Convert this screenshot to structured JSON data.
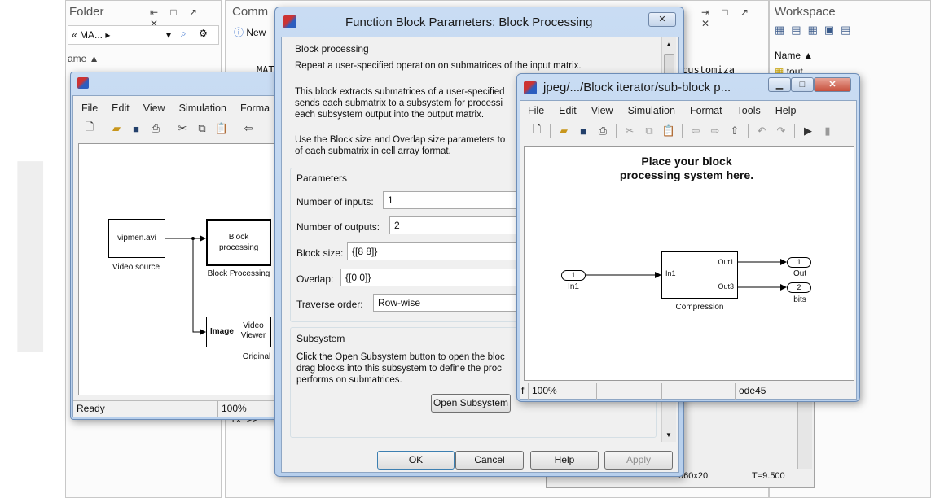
{
  "desktop": {
    "folder_title": "Folder",
    "folder_path": "« MA... ▸",
    "folder_col": "ame ▲",
    "command_title": "Comm",
    "command_new": "New",
    "command_text1": "MAT",
    "command_text2": "customiza",
    "command_prompt": "fx >>",
    "workspace_title": "Workspace",
    "workspace_col": "Name ▲",
    "workspace_var": "tout",
    "size_readout": "960x20",
    "time_readout": "T=9.500"
  },
  "model": {
    "menu": [
      "File",
      "Edit",
      "View",
      "Simulation",
      "Forma"
    ],
    "video_source_label": "vipmen.avi",
    "video_source_caption": "Video source",
    "block_proc_label": "Block processing",
    "block_proc_caption": "Block Processing",
    "viewer_in": "Image",
    "viewer_label": "Video Viewer",
    "viewer_caption": "Original",
    "status_ready": "Ready",
    "status_zoom": "100%"
  },
  "dialog": {
    "title": "Function Block Parameters: Block Processing",
    "section1": "Block processing",
    "desc1": "Repeat a user-specified operation on submatrices of the input matrix.",
    "desc2a": "This block extracts submatrices of a user-specified",
    "desc2b": "sends each submatrix to a subsystem for processi",
    "desc2c": "each subsystem output into the output matrix.",
    "desc3a": "Use the Block size and Overlap size parameters to",
    "desc3b": "of each submatrix in cell array format.",
    "params_title": "Parameters",
    "inputs_label": "Number of inputs:",
    "inputs_value": "1",
    "outputs_label": "Number of outputs:",
    "outputs_value": "2",
    "blocksize_label": "Block size:",
    "blocksize_value": "{[8 8]}",
    "overlap_label": "Overlap:",
    "overlap_value": "{[0 0]}",
    "traverse_label": "Traverse order:",
    "traverse_value": "Row-wise",
    "subsystem_title": "Subsystem",
    "sub1": "Click the Open Subsystem button to open the bloc",
    "sub2": "drag blocks into this subsystem to define the proc",
    "sub3": "performs on submatrices.",
    "open_subsystem": "Open Subsystem",
    "ok": "OK",
    "cancel": "Cancel",
    "help": "Help",
    "apply": "Apply"
  },
  "subwin": {
    "title": "jpeg/.../Block iterator/sub-block p...",
    "menu": [
      "File",
      "Edit",
      "View",
      "Simulation",
      "Format",
      "Tools",
      "Help"
    ],
    "heading1": "Place your block",
    "heading2": "processing system here.",
    "in_num": "1",
    "in_label": "In1",
    "block_in": "In1",
    "block_out1": "Out1",
    "block_out3": "Out3",
    "block_caption": "Compression",
    "out1_num": "1",
    "out1_label": "Out",
    "out2_num": "2",
    "out2_label": "bits",
    "status_zoom": "100%",
    "status_prefix": "f",
    "status_solver": "ode45"
  },
  "watermark": "In"
}
